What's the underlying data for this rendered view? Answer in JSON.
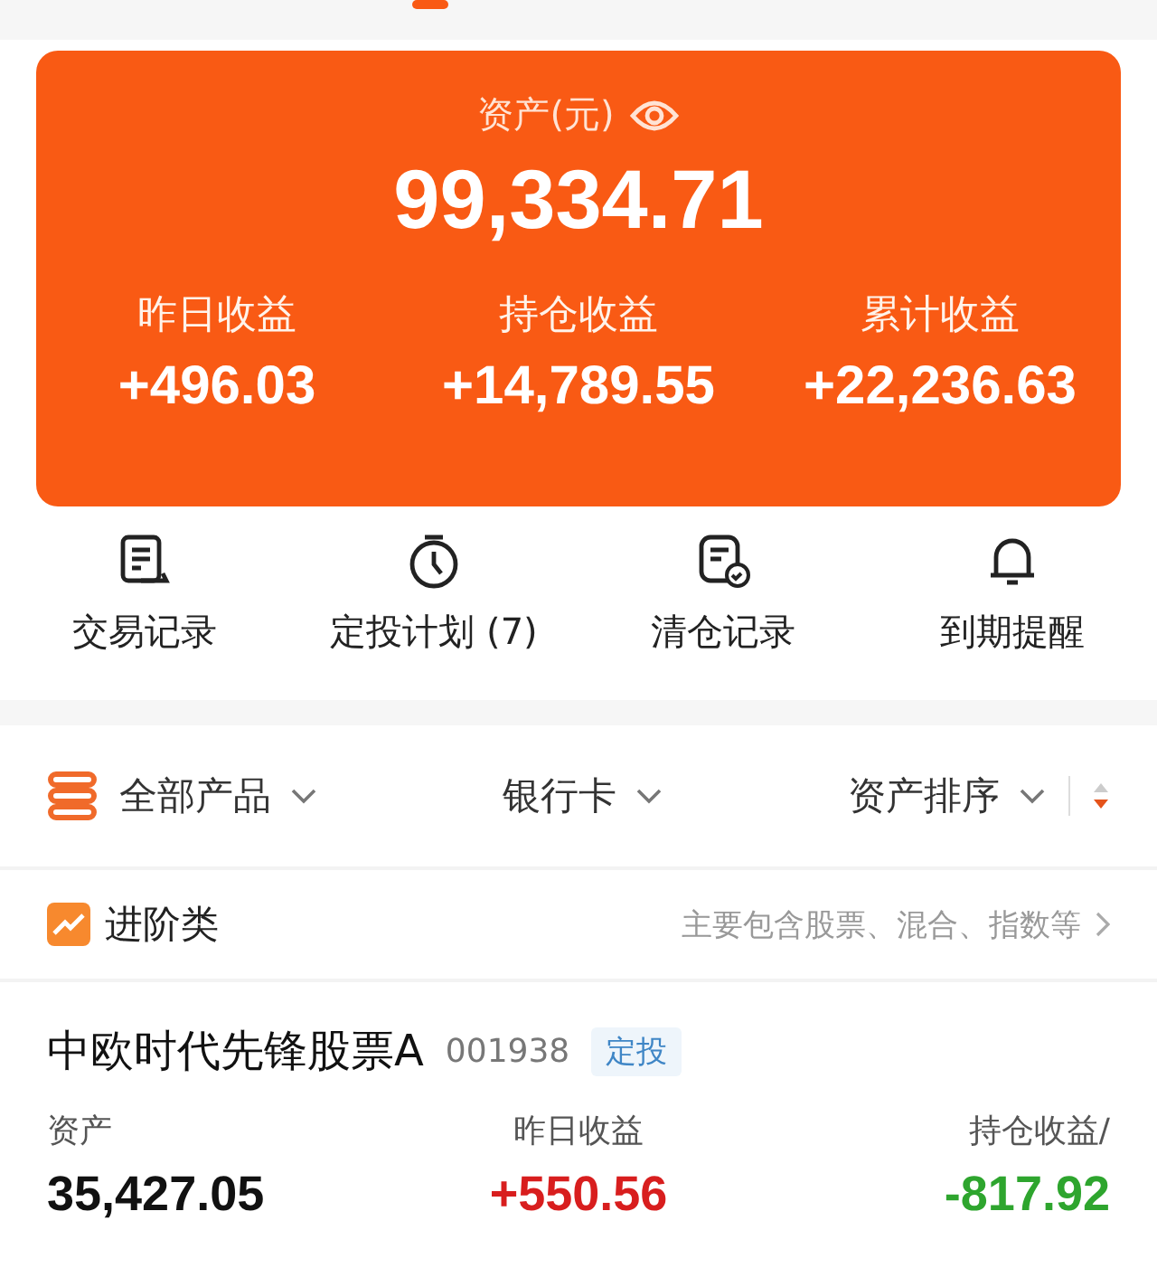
{
  "summary": {
    "label": "资产(元)",
    "total": "99,334.71",
    "stats": [
      {
        "label": "昨日收益",
        "value": "+496.03"
      },
      {
        "label": "持仓收益",
        "value": "+14,789.55"
      },
      {
        "label": "累计收益",
        "value": "+22,236.63"
      }
    ]
  },
  "actions": [
    {
      "kind": "receipt",
      "label": "交易记录"
    },
    {
      "kind": "timer",
      "label": "定投计划 (7)"
    },
    {
      "kind": "doccheck",
      "label": "清仓记录"
    },
    {
      "kind": "bell",
      "label": "到期提醒"
    }
  ],
  "filters": [
    {
      "label": "全部产品"
    },
    {
      "label": "银行卡"
    },
    {
      "label": "资产排序"
    }
  ],
  "category": {
    "title": "进阶类",
    "hint": "主要包含股票、混合、指数等"
  },
  "fund": {
    "name": "中欧时代先锋股票A",
    "code": "001938",
    "tag": "定投",
    "metrics": [
      {
        "label": "资产",
        "value": "35,427.05",
        "color": "#111111"
      },
      {
        "label": "昨日收益",
        "value": "+550.56",
        "color": "#d81e1e"
      },
      {
        "label": "持仓收益/",
        "value": "-817.92",
        "color": "#2ea52e"
      }
    ]
  }
}
